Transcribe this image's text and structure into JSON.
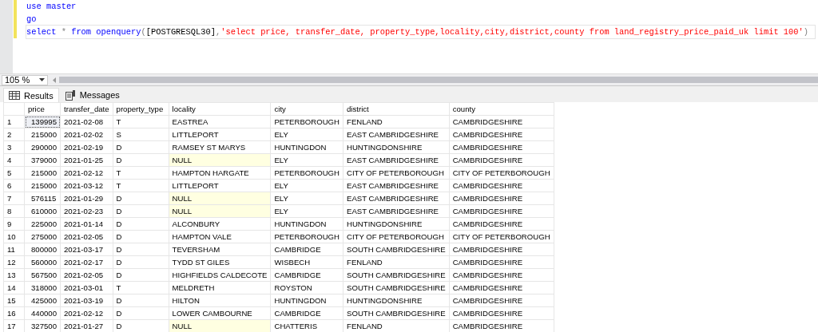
{
  "editor": {
    "lines": [
      {
        "changed": true,
        "current": false,
        "tokens": [
          {
            "kind": "keyword",
            "text": "use master"
          }
        ]
      },
      {
        "changed": true,
        "current": false,
        "tokens": [
          {
            "kind": "keyword",
            "text": "go"
          }
        ]
      },
      {
        "changed": true,
        "current": true,
        "tokens": [
          {
            "kind": "keyword",
            "text": "select"
          },
          {
            "kind": "operator",
            "text": " * "
          },
          {
            "kind": "keyword",
            "text": "from"
          },
          {
            "kind": "keyword",
            "text": " openquery"
          },
          {
            "kind": "operator",
            "text": "("
          },
          {
            "kind": "plain",
            "text": "[POSTGRESQL30]"
          },
          {
            "kind": "operator",
            "text": ","
          },
          {
            "kind": "string",
            "text": "'select price, transfer_date, property_type,locality,city,district,county from land_registry_price_paid_uk limit 100'"
          },
          {
            "kind": "operator",
            "text": ")"
          }
        ]
      }
    ]
  },
  "zoom": {
    "value": "105 %"
  },
  "tabs": [
    {
      "label": "Results",
      "selected": true
    },
    {
      "label": "Messages",
      "selected": false
    }
  ],
  "table": {
    "columns": [
      "price",
      "transfer_date",
      "property_type",
      "locality",
      "city",
      "district",
      "county"
    ],
    "rows": [
      {
        "number": "1",
        "selected": true,
        "locality_null": false,
        "cells": [
          "139995",
          "2021-02-08",
          "T",
          "EASTREA",
          "PETERBOROUGH",
          "FENLAND",
          "CAMBRIDGESHIRE"
        ]
      },
      {
        "number": "2",
        "selected": false,
        "locality_null": false,
        "cells": [
          "215000",
          "2021-02-02",
          "S",
          "LITTLEPORT",
          "ELY",
          "EAST CAMBRIDGESHIRE",
          "CAMBRIDGESHIRE"
        ]
      },
      {
        "number": "3",
        "selected": false,
        "locality_null": false,
        "cells": [
          "290000",
          "2021-02-19",
          "D",
          "RAMSEY ST MARYS",
          "HUNTINGDON",
          "HUNTINGDONSHIRE",
          "CAMBRIDGESHIRE"
        ]
      },
      {
        "number": "4",
        "selected": false,
        "locality_null": true,
        "cells": [
          "379000",
          "2021-01-25",
          "D",
          "NULL",
          "ELY",
          "EAST CAMBRIDGESHIRE",
          "CAMBRIDGESHIRE"
        ]
      },
      {
        "number": "5",
        "selected": false,
        "locality_null": false,
        "cells": [
          "215000",
          "2021-02-12",
          "T",
          "HAMPTON HARGATE",
          "PETERBOROUGH",
          "CITY OF PETERBOROUGH",
          "CITY OF PETERBOROUGH"
        ]
      },
      {
        "number": "6",
        "selected": false,
        "locality_null": false,
        "cells": [
          "215000",
          "2021-03-12",
          "T",
          "LITTLEPORT",
          "ELY",
          "EAST CAMBRIDGESHIRE",
          "CAMBRIDGESHIRE"
        ]
      },
      {
        "number": "7",
        "selected": false,
        "locality_null": true,
        "cells": [
          "576115",
          "2021-01-29",
          "D",
          "NULL",
          "ELY",
          "EAST CAMBRIDGESHIRE",
          "CAMBRIDGESHIRE"
        ]
      },
      {
        "number": "8",
        "selected": false,
        "locality_null": true,
        "cells": [
          "610000",
          "2021-02-23",
          "D",
          "NULL",
          "ELY",
          "EAST CAMBRIDGESHIRE",
          "CAMBRIDGESHIRE"
        ]
      },
      {
        "number": "9",
        "selected": false,
        "locality_null": false,
        "cells": [
          "225000",
          "2021-01-14",
          "D",
          "ALCONBURY",
          "HUNTINGDON",
          "HUNTINGDONSHIRE",
          "CAMBRIDGESHIRE"
        ]
      },
      {
        "number": "10",
        "selected": false,
        "locality_null": false,
        "cells": [
          "275000",
          "2021-02-05",
          "D",
          "HAMPTON VALE",
          "PETERBOROUGH",
          "CITY OF PETERBOROUGH",
          "CITY OF PETERBOROUGH"
        ]
      },
      {
        "number": "11",
        "selected": false,
        "locality_null": false,
        "cells": [
          "800000",
          "2021-03-17",
          "D",
          "TEVERSHAM",
          "CAMBRIDGE",
          "SOUTH CAMBRIDGESHIRE",
          "CAMBRIDGESHIRE"
        ]
      },
      {
        "number": "12",
        "selected": false,
        "locality_null": false,
        "cells": [
          "560000",
          "2021-02-17",
          "D",
          "TYDD ST GILES",
          "WISBECH",
          "FENLAND",
          "CAMBRIDGESHIRE"
        ]
      },
      {
        "number": "13",
        "selected": false,
        "locality_null": false,
        "cells": [
          "567500",
          "2021-02-05",
          "D",
          "HIGHFIELDS CALDECOTE",
          "CAMBRIDGE",
          "SOUTH CAMBRIDGESHIRE",
          "CAMBRIDGESHIRE"
        ]
      },
      {
        "number": "14",
        "selected": false,
        "locality_null": false,
        "cells": [
          "318000",
          "2021-03-01",
          "T",
          "MELDRETH",
          "ROYSTON",
          "SOUTH CAMBRIDGESHIRE",
          "CAMBRIDGESHIRE"
        ]
      },
      {
        "number": "15",
        "selected": false,
        "locality_null": false,
        "cells": [
          "425000",
          "2021-03-19",
          "D",
          "HILTON",
          "HUNTINGDON",
          "HUNTINGDONSHIRE",
          "CAMBRIDGESHIRE"
        ]
      },
      {
        "number": "16",
        "selected": false,
        "locality_null": false,
        "cells": [
          "440000",
          "2021-02-12",
          "D",
          "LOWER CAMBOURNE",
          "CAMBRIDGE",
          "SOUTH CAMBRIDGESHIRE",
          "CAMBRIDGESHIRE"
        ]
      },
      {
        "number": "17",
        "selected": false,
        "locality_null": true,
        "cells": [
          "327500",
          "2021-01-27",
          "D",
          "NULL",
          "CHATTERIS",
          "FENLAND",
          "CAMBRIDGESHIRE"
        ]
      }
    ]
  }
}
